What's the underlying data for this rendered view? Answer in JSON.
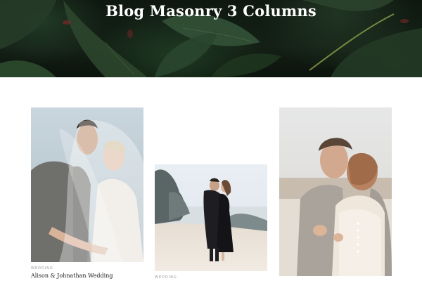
{
  "hero": {
    "title": "Blog Masonry 3 Columns"
  },
  "posts": [
    {
      "category": "WEDDING",
      "title": "Alison & Johnathan Wedding",
      "image": "couple-veil-kiss-photo"
    },
    {
      "category": "WEDDING",
      "title": "",
      "image": "couple-beach-embrace-photo"
    },
    {
      "category": "",
      "title": "",
      "image": "couple-lace-dress-photo"
    }
  ]
}
